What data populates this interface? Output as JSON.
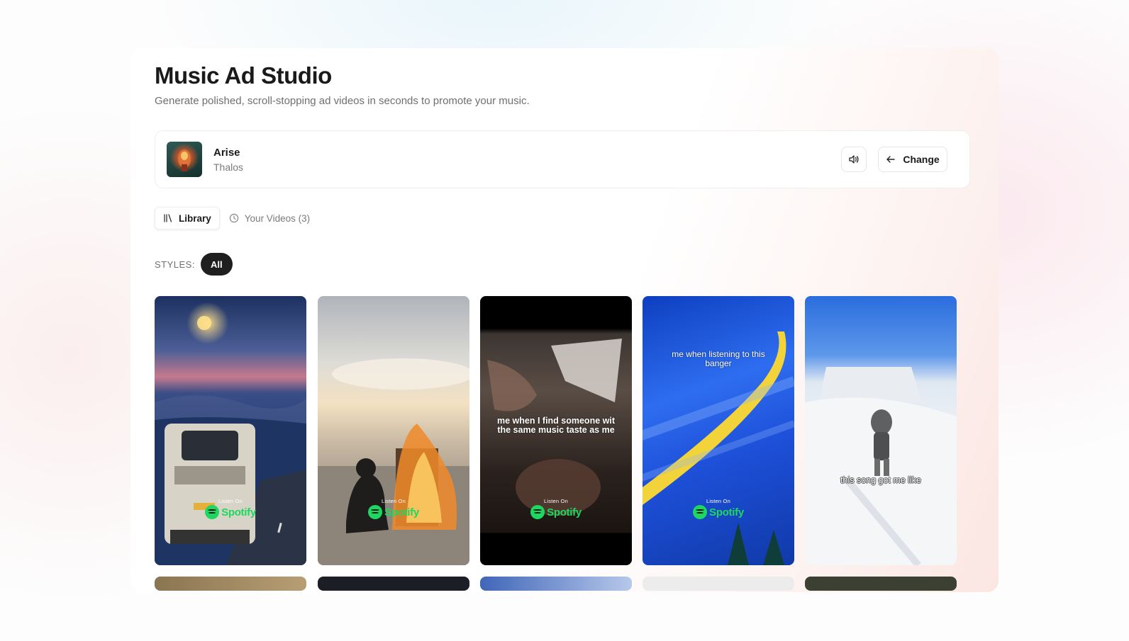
{
  "page": {
    "title": "Music Ad Studio",
    "subtitle": "Generate polished, scroll-stopping ad videos in seconds to promote your music."
  },
  "track": {
    "name": "Arise",
    "artist": "Thalos",
    "cover_icon": "album-cover",
    "volume_icon": "speaker-icon",
    "change_label": "Change",
    "change_icon": "arrow-left-icon"
  },
  "tabs": [
    {
      "label": "Library",
      "icon": "library-icon",
      "active": true
    },
    {
      "label": "Your Videos (3)",
      "icon": "clock-icon",
      "active": false
    }
  ],
  "styles": {
    "label": "STYLES:",
    "chips": [
      {
        "label": "All",
        "selected": true
      }
    ]
  },
  "videos": [
    {
      "caption": "",
      "listen_on": "Listen On",
      "brand": "Spotify"
    },
    {
      "caption": "",
      "listen_on": "Listen On",
      "brand": "Spotify"
    },
    {
      "caption": "me when I find someone wit the same music taste as me",
      "listen_on": "Listen On",
      "brand": "Spotify"
    },
    {
      "caption": "me when listening to this banger",
      "listen_on": "Listen On",
      "brand": "Spotify"
    },
    {
      "caption": "this song got me like",
      "listen_on": "",
      "brand": ""
    }
  ],
  "colors": {
    "accent": "#1f1f1f",
    "spotify_green": "#1ed760"
  }
}
